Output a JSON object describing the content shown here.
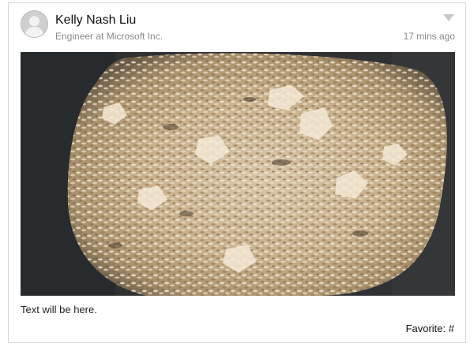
{
  "post": {
    "author": {
      "name": "Kelly Nash Liu",
      "title": "Engineer at Microsoft Inc.",
      "avatar_icon": "user-silhouette-icon"
    },
    "timestamp": "17 mins ago",
    "menu_icon": "caret-down-icon",
    "image": {
      "description_icon": "photo"
    },
    "text": "Text will be here.",
    "favorite": {
      "label": "Favorite:",
      "count": "#"
    }
  },
  "colors": {
    "border": "#d7d7d7",
    "secondary_text": "#8a8a8a",
    "primary_text": "#111111",
    "pan": "#2f3133"
  }
}
